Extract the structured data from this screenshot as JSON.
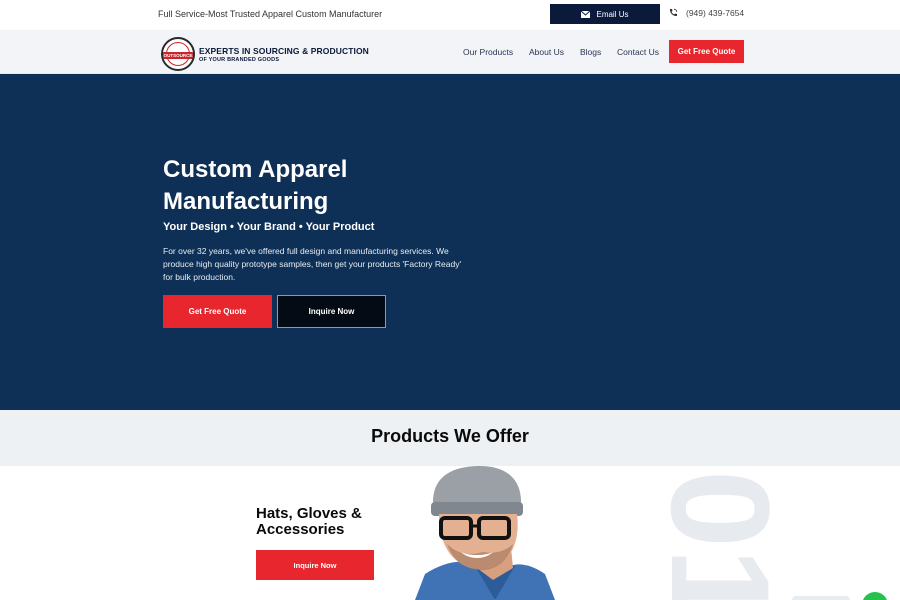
{
  "topbar": {
    "tagline": "Full Service-Most Trusted Apparel Custom Manufacturer",
    "email_label": "Email Us",
    "phone": "(949) 439-7654"
  },
  "logo": {
    "badge_text": "OUTSOURCE",
    "line1": "EXPERTS IN SOURCING & PRODUCTION",
    "line2": "OF YOUR BRANDED GOODS"
  },
  "nav": {
    "items": [
      {
        "label": "Our Products"
      },
      {
        "label": "About Us"
      },
      {
        "label": "Blogs"
      },
      {
        "label": "Contact Us"
      }
    ],
    "cta_label": "Get Free Quote"
  },
  "hero": {
    "title": "Custom Apparel Manufacturing",
    "subtitle": "Your Design • Your Brand • Your Product",
    "description": "For over 32 years, we've offered full design and manufacturing services. We produce high quality prototype samples, then get your products 'Factory Ready' for bulk production.",
    "primary_button": "Get Free Quote",
    "secondary_button": "Inquire Now"
  },
  "products": {
    "heading": "Products We Offer",
    "current": {
      "number": "01",
      "title": "Hats, Gloves & Accessories",
      "button": "Inquire Now"
    }
  },
  "colors": {
    "navy": "#0f3056",
    "dark": "#0b1a3a",
    "accent_red": "#e8262d",
    "chat_green": "#27c24c"
  },
  "icons": [
    "envelope-icon",
    "phone-icon",
    "chat-icon"
  ]
}
